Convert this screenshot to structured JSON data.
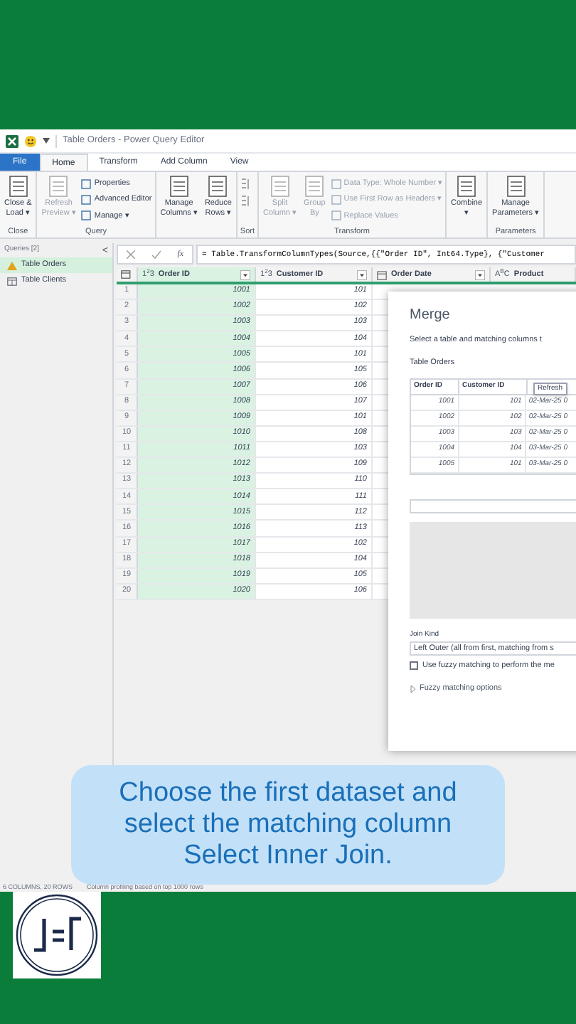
{
  "title_bar": {
    "title": "Table Orders - Power Query Editor"
  },
  "ribbon_tabs": [
    {
      "label": "File",
      "selected": false,
      "kind": "file"
    },
    {
      "label": "Home",
      "selected": true,
      "kind": "tab"
    },
    {
      "label": "Transform",
      "selected": false,
      "kind": "tab"
    },
    {
      "label": "Add Column",
      "selected": false,
      "kind": "tab"
    },
    {
      "label": "View",
      "selected": false,
      "kind": "tab"
    }
  ],
  "ribbon_groups": [
    {
      "label": "Close",
      "items": [
        {
          "kind": "large",
          "label": "Close &\nLoad ▾",
          "disabled": false
        }
      ]
    },
    {
      "label": "Query",
      "items": [
        {
          "kind": "large",
          "label": "Refresh\nPreview ▾",
          "disabled": true
        },
        {
          "kind": "stack",
          "entries": [
            {
              "label": "Properties",
              "disabled": false
            },
            {
              "label": "Advanced Editor",
              "disabled": false
            },
            {
              "label": "Manage ▾",
              "disabled": false
            }
          ]
        }
      ]
    },
    {
      "items": [
        {
          "kind": "large",
          "label": "Manage\nColumns ▾",
          "disabled": false
        },
        {
          "kind": "large",
          "label": "Reduce\nRows ▾",
          "disabled": false
        }
      ]
    },
    {
      "label": "Sort",
      "items": [
        {
          "kind": "sort"
        }
      ]
    },
    {
      "label": "Transform",
      "items": [
        {
          "kind": "large",
          "label": "Split\nColumn ▾",
          "disabled": true
        },
        {
          "kind": "large",
          "label": "Group\nBy",
          "disabled": true
        },
        {
          "kind": "stack",
          "entries": [
            {
              "label": "Data Type: Whole Number ▾",
              "disabled": true
            },
            {
              "label": "Use First Row as Headers ▾",
              "disabled": true
            },
            {
              "label": "Replace Values",
              "disabled": true
            }
          ]
        }
      ]
    },
    {
      "items": [
        {
          "kind": "large",
          "label": "Combine\n▾",
          "disabled": false
        }
      ]
    },
    {
      "label": "Parameters",
      "items": [
        {
          "kind": "large",
          "label": "Manage\nParameters ▾",
          "disabled": false
        }
      ]
    }
  ],
  "queries": {
    "header": "Queries [2]",
    "collapse": "<",
    "items": [
      {
        "name": "Table Orders",
        "selected": true,
        "kind": "warning"
      },
      {
        "name": "Table Clients",
        "selected": false,
        "kind": "table"
      }
    ]
  },
  "formula_bar": {
    "fx": "fx",
    "formula": "= Table.TransformColumnTypes(Source,{{\"Order ID\", Int64.Type}, {\"Customer"
  },
  "columns": [
    {
      "name": "Order ID",
      "type": "1$^{2}$3",
      "kind": "number",
      "selected": true
    },
    {
      "name": "Customer ID",
      "type": "1$^{2}$3",
      "kind": "number",
      "selected": false
    },
    {
      "name": "Order Date",
      "kind": "date",
      "selected": false
    },
    {
      "name": "Product",
      "type": "A$^{B}$C",
      "kind": "text",
      "selected": false
    }
  ],
  "rows": [
    {
      "n": "1",
      "order_id": "1001",
      "customer_id": "101"
    },
    {
      "n": "2",
      "order_id": "1002",
      "customer_id": "102"
    },
    {
      "n": "3",
      "order_id": "1003",
      "customer_id": "103"
    },
    {
      "n": "4",
      "order_id": "1004",
      "customer_id": "104"
    },
    {
      "n": "5",
      "order_id": "1005",
      "customer_id": "101"
    },
    {
      "n": "6",
      "order_id": "1006",
      "customer_id": "105"
    },
    {
      "n": "7",
      "order_id": "1007",
      "customer_id": "106"
    },
    {
      "n": "8",
      "order_id": "1008",
      "customer_id": "107"
    },
    {
      "n": "9",
      "order_id": "1009",
      "customer_id": "101"
    },
    {
      "n": "10",
      "order_id": "1010",
      "customer_id": "108"
    },
    {
      "n": "11",
      "order_id": "1011",
      "customer_id": "103"
    },
    {
      "n": "12",
      "order_id": "1012",
      "customer_id": "109"
    },
    {
      "n": "13",
      "order_id": "1013",
      "customer_id": "110"
    },
    {
      "n": "14",
      "order_id": "1014",
      "customer_id": "111"
    },
    {
      "n": "15",
      "order_id": "1015",
      "customer_id": "112"
    },
    {
      "n": "16",
      "order_id": "1016",
      "customer_id": "113"
    },
    {
      "n": "17",
      "order_id": "1017",
      "customer_id": "102"
    },
    {
      "n": "18",
      "order_id": "1018",
      "customer_id": "104"
    },
    {
      "n": "19",
      "order_id": "1019",
      "customer_id": "105"
    },
    {
      "n": "20",
      "order_id": "1020",
      "customer_id": "106"
    }
  ],
  "merge_dialog": {
    "title": "Merge",
    "subtitle": "Select a table and matching columns t",
    "table_label": "Table Orders",
    "preview_columns": [
      "Order ID",
      "Customer ID"
    ],
    "tooltip": "Refresh",
    "preview_rows": [
      [
        "1001",
        "101",
        "02-Mar-25 0"
      ],
      [
        "1002",
        "102",
        "02-Mar-25 0"
      ],
      [
        "1003",
        "103",
        "02-Mar-25 0"
      ],
      [
        "1004",
        "104",
        "03-Mar-25 0"
      ],
      [
        "1005",
        "101",
        "03-Mar-25 0"
      ]
    ],
    "join_kind_label": "Join Kind",
    "join_kind": "Left Outer (all from first, matching from s",
    "fuzzy": {
      "label": "Use fuzzy matching to perform the me",
      "checked": false
    },
    "fuzzy_options": {
      "label": "Fuzzy matching options",
      "expanded": false
    }
  },
  "caption": [
    "Choose the first dataset and",
    "select the matching column",
    "Select Inner Join."
  ],
  "status_bar": {
    "columns": "6 COLUMNS, 20 ROWS",
    "profiling": "Column profiling based on top 1000 rows"
  }
}
